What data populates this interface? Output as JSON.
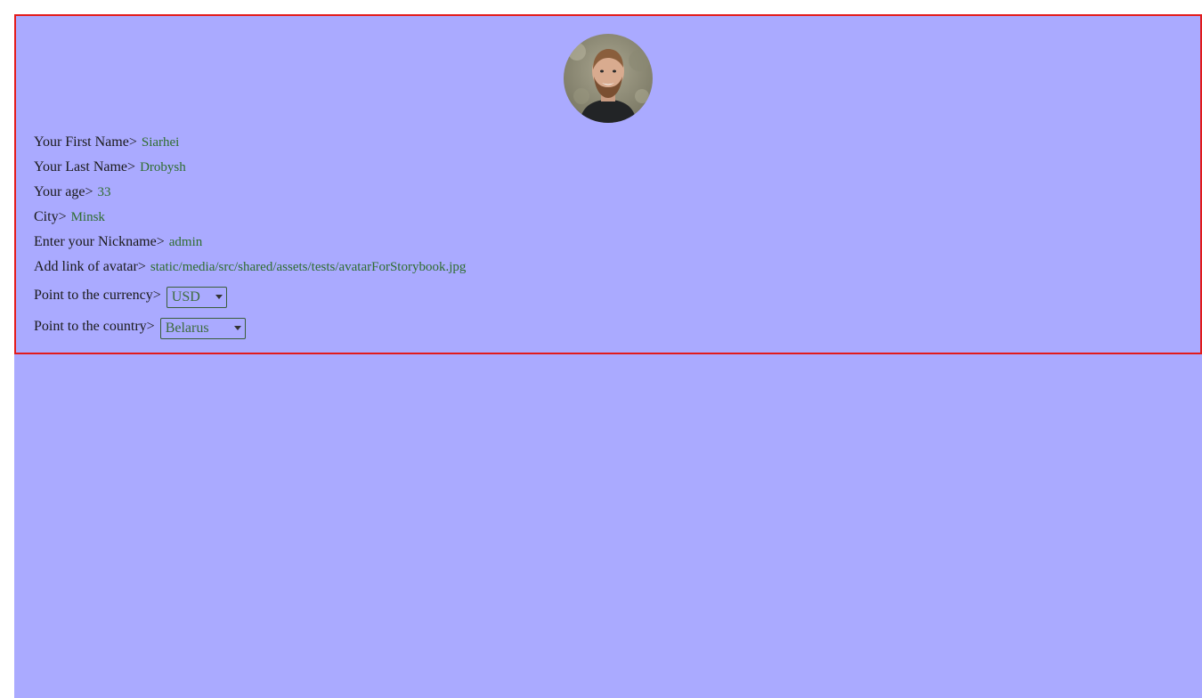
{
  "profile": {
    "avatar_alt": "avatar",
    "fields": [
      {
        "label": "Your First Name>",
        "value": "Siarhei"
      },
      {
        "label": "Your Last Name>",
        "value": "Drobysh"
      },
      {
        "label": "Your age>",
        "value": "33"
      },
      {
        "label": "City>",
        "value": "Minsk"
      },
      {
        "label": "Enter your Nickname>",
        "value": "admin"
      },
      {
        "label": "Add link of avatar>",
        "value": "static/media/src/shared/assets/tests/avatarForStorybook.jpg"
      }
    ],
    "currency": {
      "label": "Point to the currency>",
      "selected": "USD"
    },
    "country": {
      "label": "Point to the country>",
      "selected": "Belarus"
    }
  },
  "colors": {
    "page_bg": "#aaaaff",
    "card_border": "#e21b1b",
    "value_text": "#2f6d2f",
    "label_text": "#1a1a1a"
  }
}
